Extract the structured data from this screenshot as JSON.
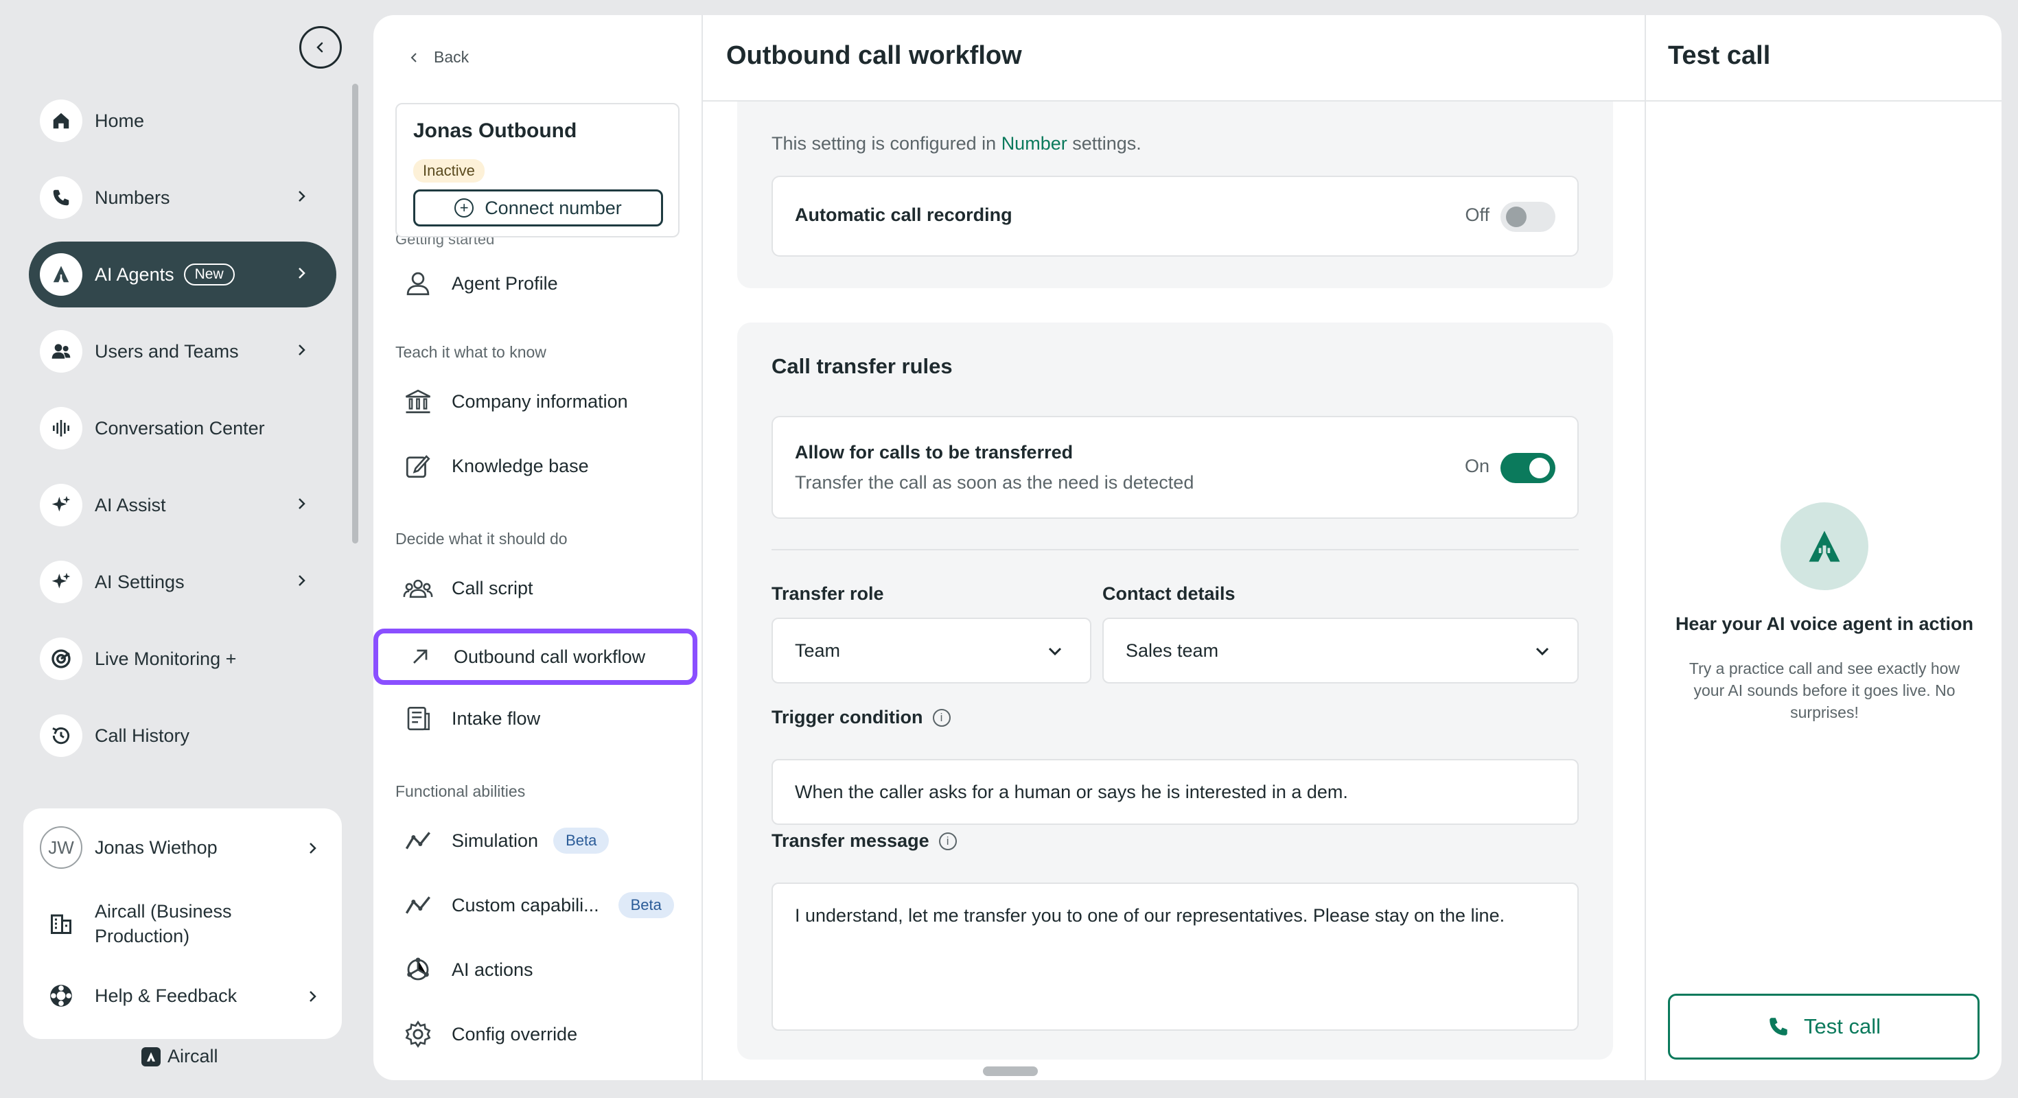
{
  "sidebar": {
    "items": [
      {
        "label": "Home",
        "icon": "home-icon"
      },
      {
        "label": "Numbers",
        "icon": "phone-icon"
      },
      {
        "label": "AI Agents",
        "icon": "ai-agent-icon",
        "badge": "New"
      },
      {
        "label": "Users and Teams",
        "icon": "users-icon"
      },
      {
        "label": "Conversation Center",
        "icon": "waveform-icon"
      },
      {
        "label": "AI Assist",
        "icon": "sparkle-icon"
      },
      {
        "label": "AI Settings",
        "icon": "sparkle-icon"
      },
      {
        "label": "Live Monitoring +",
        "icon": "monitoring-icon"
      },
      {
        "label": "Call History",
        "icon": "history-icon"
      }
    ],
    "user": {
      "initials": "JW",
      "name": "Jonas Wiethop"
    },
    "company": {
      "name": "Aircall (Business Production)"
    },
    "help": {
      "label": "Help & Feedback"
    },
    "brand": "Aircall"
  },
  "agent_panel": {
    "back_label": "Back",
    "agent_name": "Jonas Outbound",
    "status": "Inactive",
    "connect_label": "Connect number",
    "peek_heading": "Getting started",
    "getting_started": [
      {
        "label": "Agent Profile"
      }
    ],
    "teach_heading": "Teach it what to know",
    "teach": [
      {
        "label": "Company information"
      },
      {
        "label": "Knowledge base"
      }
    ],
    "decide_heading": "Decide what it should do",
    "decide": [
      {
        "label": "Call script"
      },
      {
        "label": "Outbound call workflow"
      },
      {
        "label": "Intake flow"
      }
    ],
    "functional_heading": "Functional abilities",
    "functional": [
      {
        "label": "Simulation",
        "badge": "Beta"
      },
      {
        "label": "Custom capabili...",
        "badge": "Beta"
      },
      {
        "label": "AI actions"
      },
      {
        "label": "Config override"
      }
    ]
  },
  "main": {
    "title": "Outbound call workflow",
    "recording": {
      "info_prefix": "This setting is configured in",
      "info_link": "Number",
      "info_suffix": "settings.",
      "toggle_label": "Automatic call recording",
      "state": "Off"
    },
    "transfer": {
      "heading": "Call transfer rules",
      "allow_label": "Allow for calls to be transferred",
      "allow_sub": "Transfer the call as soon as the need is detected",
      "state": "On",
      "role_label": "Transfer role",
      "role_value": "Team",
      "contact_label": "Contact details",
      "contact_value": "Sales team",
      "trigger_label": "Trigger condition",
      "trigger_value": "When the caller asks for a human or says he is interested in a dem.",
      "message_label": "Transfer message",
      "message_value": "I understand, let me transfer you to one of our representatives. Please stay on the line."
    }
  },
  "test_call": {
    "title": "Test call",
    "heading": "Hear your AI voice agent in action",
    "description": "Try a practice call and see exactly how your AI sounds before it goes live. No surprises!",
    "button_label": "Test call"
  },
  "colors": {
    "accent": "#0b7a5c",
    "active_nav": "#32474c",
    "highlight": "#8a4fff"
  }
}
